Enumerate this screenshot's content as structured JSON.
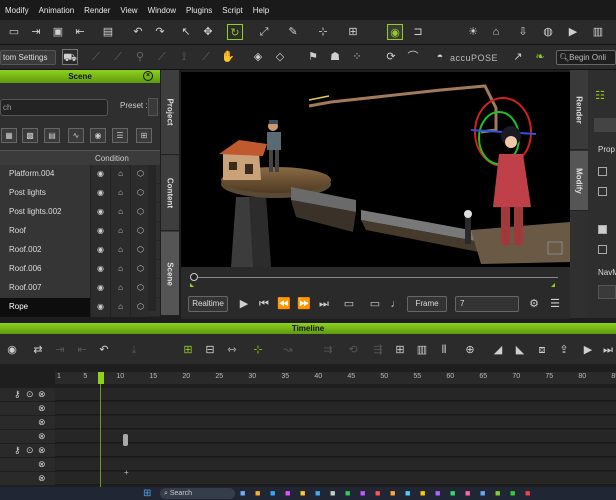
{
  "menu": [
    "Modify",
    "Animation",
    "Render",
    "View",
    "Window",
    "Plugins",
    "Script",
    "Help"
  ],
  "toolbar2": {
    "settings_label": "tom Settings",
    "accupose_label": "accuPOSE",
    "search_placeholder": "Begin Onli"
  },
  "scene": {
    "title": "Scene",
    "search_placeholder": "ch",
    "preset_label": "Preset :",
    "condition_header": "Condition",
    "rows": [
      "Platform.004",
      "Post lights",
      "Post lights.002",
      "Roof",
      "Roof.002",
      "Roof.006",
      "Roof.007",
      "Rope"
    ],
    "selected": "Rope"
  },
  "side_tabs": [
    "Project",
    "Content",
    "Scene"
  ],
  "right_tabs": [
    "Render",
    "Modify"
  ],
  "right_panel": {
    "prop_label": "Prop",
    "nav_label": "NavM"
  },
  "playbar": {
    "realtime_label": "Realtime",
    "frame_label": "Frame",
    "frame_value": "7"
  },
  "timeline": {
    "title": "Timeline",
    "ticks": [
      "1",
      "5",
      "10",
      "15",
      "20",
      "25",
      "30",
      "35",
      "40",
      "45",
      "50",
      "55",
      "60",
      "65",
      "70",
      "75",
      "80",
      "85"
    ]
  },
  "taskbar": {
    "search_label": "Search"
  },
  "colors": {
    "accent": "#8fd11d"
  }
}
